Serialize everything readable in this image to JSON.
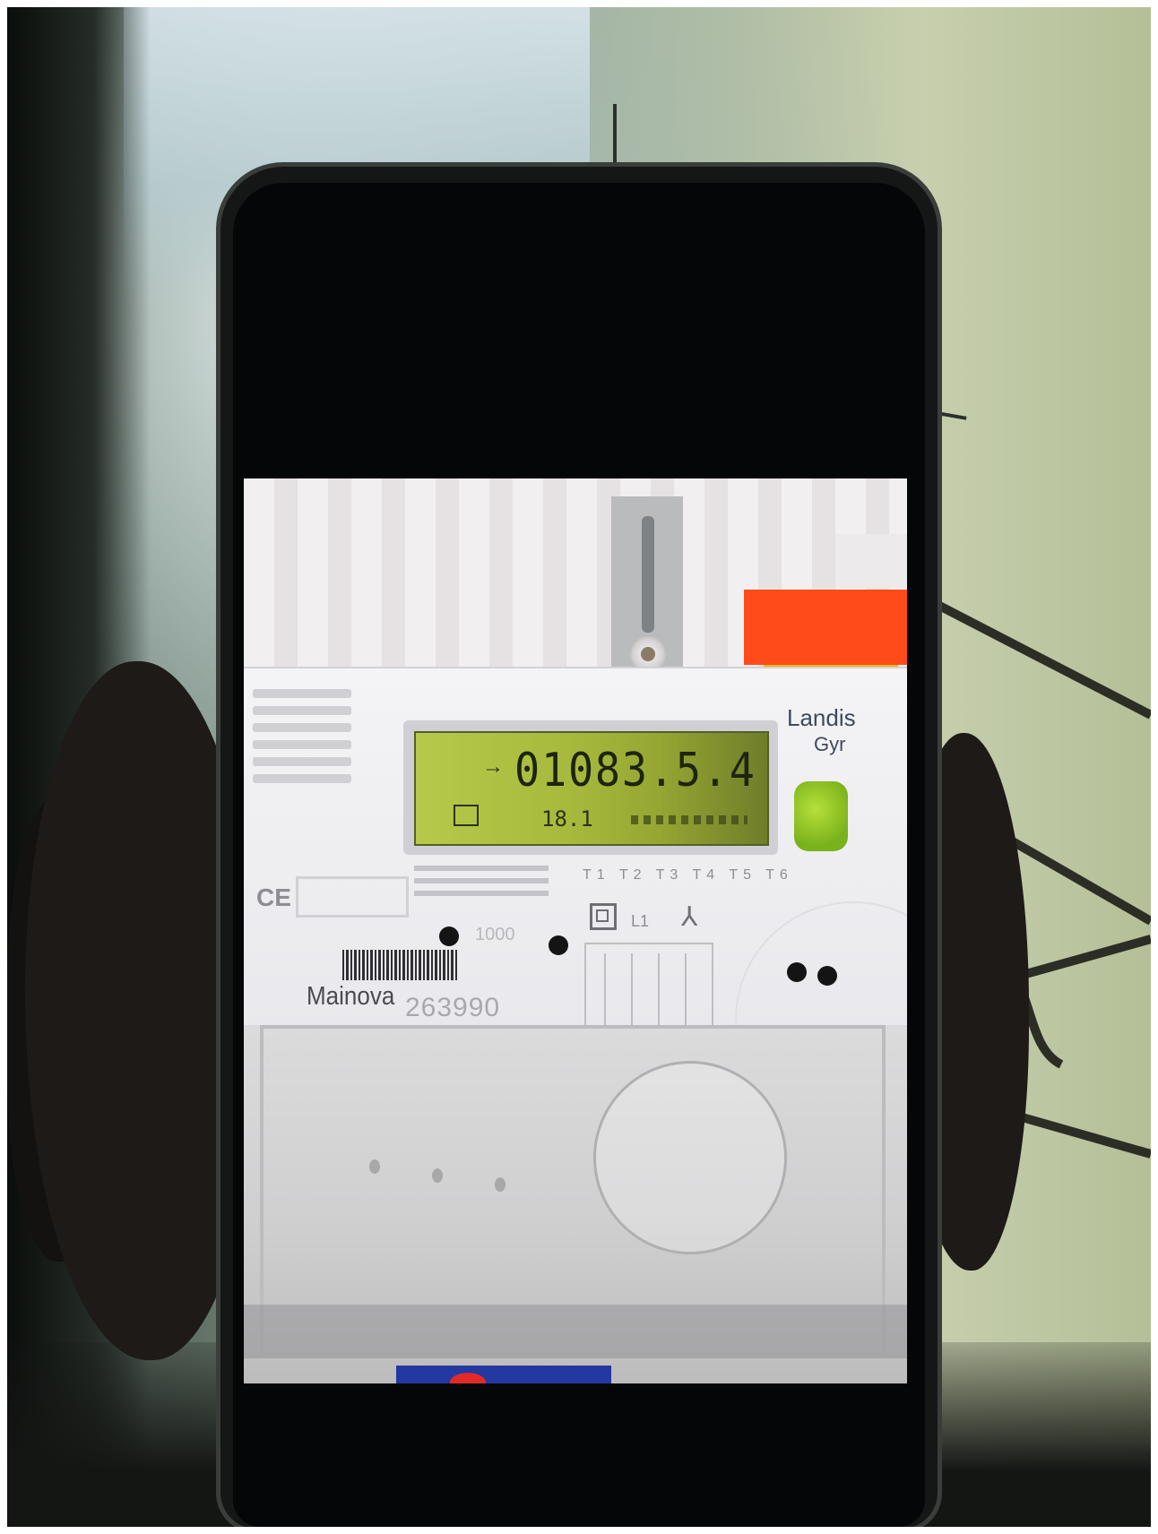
{
  "meter": {
    "display_value": "01083.5.4",
    "display_obis": "18.1",
    "brand_line1": "Landis",
    "brand_line2": "Gyr",
    "tariff_labels": "T1 T2 T3 T4 T5 T6",
    "impulse": "1000",
    "phase_label": "L1",
    "utility": "Mainova",
    "serial": "263990",
    "ce": "CE"
  },
  "colors": {
    "lcd": "#a7b93c",
    "red_label": "#ff4a1a",
    "green_button": "#7ab21b"
  }
}
